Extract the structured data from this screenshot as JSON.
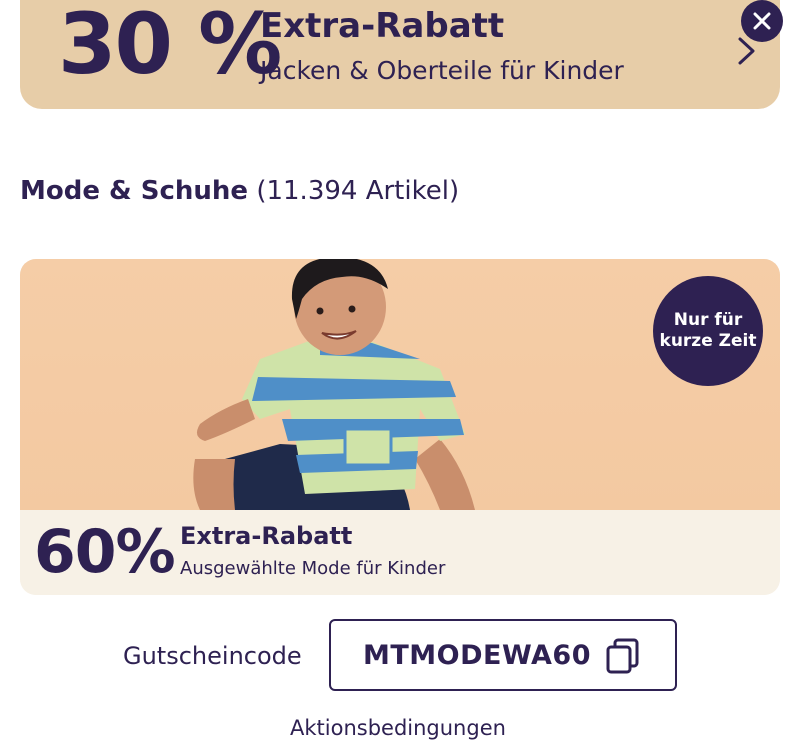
{
  "top_banner": {
    "percent": "30 %",
    "title": "Extra-Rabatt",
    "subtitle": "Jacken & Oberteile für Kinder"
  },
  "section": {
    "title": "Mode & Schuhe",
    "count": "(11.394 Artikel)"
  },
  "promo_card": {
    "badge_line1": "Nur für",
    "badge_line2": "kurze Zeit",
    "percent": "60%",
    "title": "Extra-Rabatt",
    "subtitle": "Ausgewählte Mode für Kinder"
  },
  "voucher": {
    "label": "Gutscheincode",
    "code": "MTMODEWA60"
  },
  "terms_label": "Aktionsbedingungen",
  "icons": {
    "close": "close-icon",
    "chevron": "chevron-right-icon",
    "copy": "copy-icon"
  },
  "colors": {
    "brand_dark": "#2e2152",
    "banner_bg": "#e7cda8",
    "card_image_bg": "#f5cda7",
    "card_footer_bg": "#f7f1e6"
  }
}
